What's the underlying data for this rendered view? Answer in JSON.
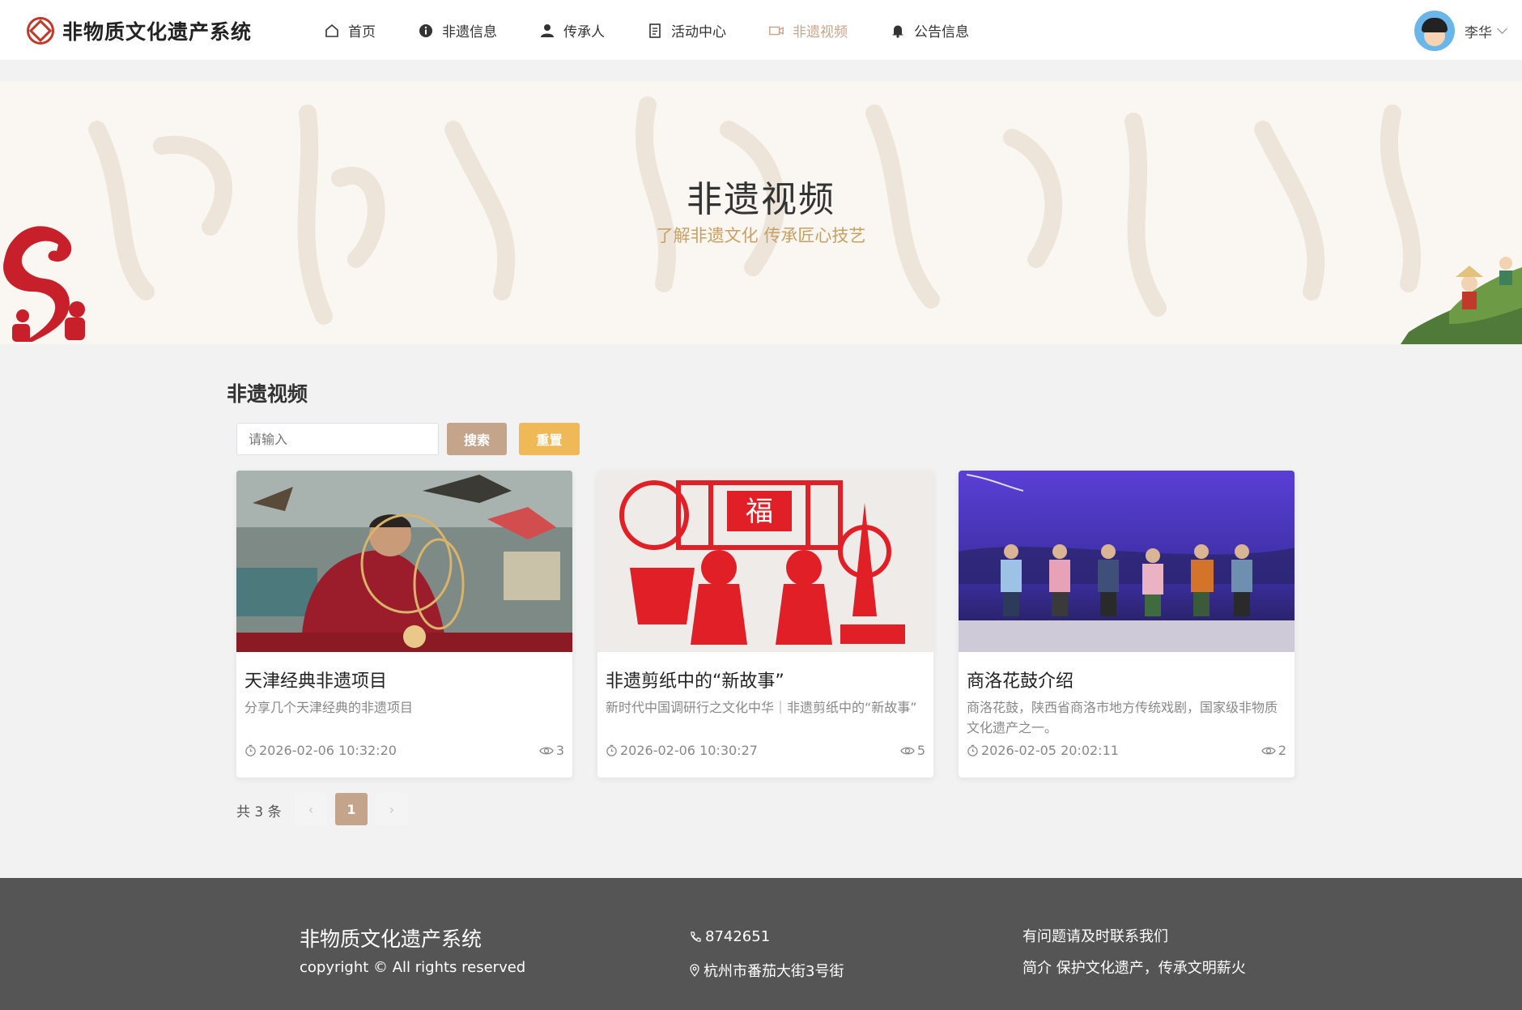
{
  "header": {
    "logo_text": "非物质文化遗产系统",
    "nav": [
      {
        "label": "首页",
        "icon": "home-icon"
      },
      {
        "label": "非遗信息",
        "icon": "info-icon"
      },
      {
        "label": "传承人",
        "icon": "person-icon"
      },
      {
        "label": "活动中心",
        "icon": "document-icon"
      },
      {
        "label": "非遗视频",
        "icon": "video-icon",
        "active": true
      },
      {
        "label": "公告信息",
        "icon": "bell-icon"
      }
    ],
    "user_name": "李华"
  },
  "banner": {
    "title": "非遗视频",
    "subtitle": "了解非遗文化 传承匠心技艺"
  },
  "section": {
    "title": "非遗视频"
  },
  "search": {
    "placeholder": "请输入",
    "search_label": "搜索",
    "reset_label": "重置"
  },
  "cards": [
    {
      "title": "天津经典非遗项目",
      "desc": "分享几个天津经典的非遗项目",
      "time": "2026-02-06 10:32:20",
      "views": "3"
    },
    {
      "title": "非遗剪纸中的“新故事”",
      "desc": "新时代中国调研行之文化中华｜非遗剪纸中的“新故事”",
      "time": "2026-02-06 10:30:27",
      "views": "5"
    },
    {
      "title": "商洛花鼓介绍",
      "desc": "商洛花鼓，陕西省商洛市地方传统戏剧，国家级非物质文化遗产之一。",
      "time": "2026-02-05 20:02:11",
      "views": "2"
    }
  ],
  "pagination": {
    "total_text": "共 3 条",
    "current_page": "1",
    "prev": "‹",
    "next": "›"
  },
  "footer": {
    "title": "非物质文化遗产系统",
    "copyright": "copyright © All rights reserved",
    "phone": "8742651",
    "address": "杭州市番茄大街3号街",
    "contact": "有问题请及时联系我们",
    "intro": "简介 保护文化遗产，传承文明薪火"
  },
  "colors": {
    "accent": "#c4a48b",
    "reset": "#f0b957",
    "active_nav": "#c9a48a",
    "footer_bg": "#555555",
    "subtitle": "#c9a063"
  }
}
